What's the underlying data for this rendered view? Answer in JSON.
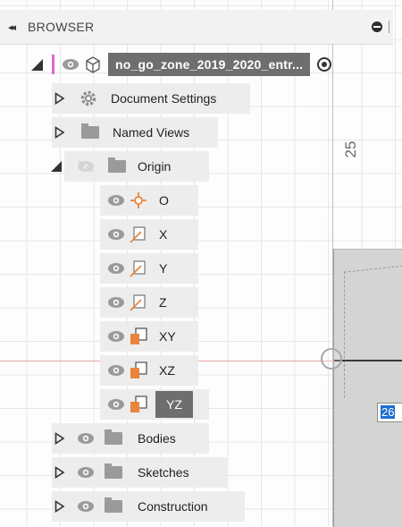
{
  "browser": {
    "title": "BROWSER",
    "collapse_glyph": "◂◂"
  },
  "tree": {
    "root": {
      "label": "no_go_zone_2019_2020_entr...",
      "accent_color": "#d66ad6"
    },
    "document_settings": "Document Settings",
    "named_views": "Named Views",
    "origin": "Origin",
    "origin_items": [
      {
        "label": "O",
        "icon": "origin-point-icon"
      },
      {
        "label": "X",
        "icon": "axis-icon"
      },
      {
        "label": "Y",
        "icon": "axis-icon"
      },
      {
        "label": "Z",
        "icon": "axis-icon"
      },
      {
        "label": "XY",
        "icon": "plane-icon"
      },
      {
        "label": "XZ",
        "icon": "plane-icon"
      },
      {
        "label": "YZ",
        "icon": "plane-icon",
        "selected": true
      }
    ],
    "bodies": "Bodies",
    "sketches": "Sketches",
    "construction": "Construction"
  },
  "canvas": {
    "ruler_value": "25",
    "dimension_value": "26"
  },
  "colors": {
    "origin_orange": "#e8853a",
    "selection_gray": "#6e6e6e",
    "eye_gray": "#9a9a9a"
  }
}
